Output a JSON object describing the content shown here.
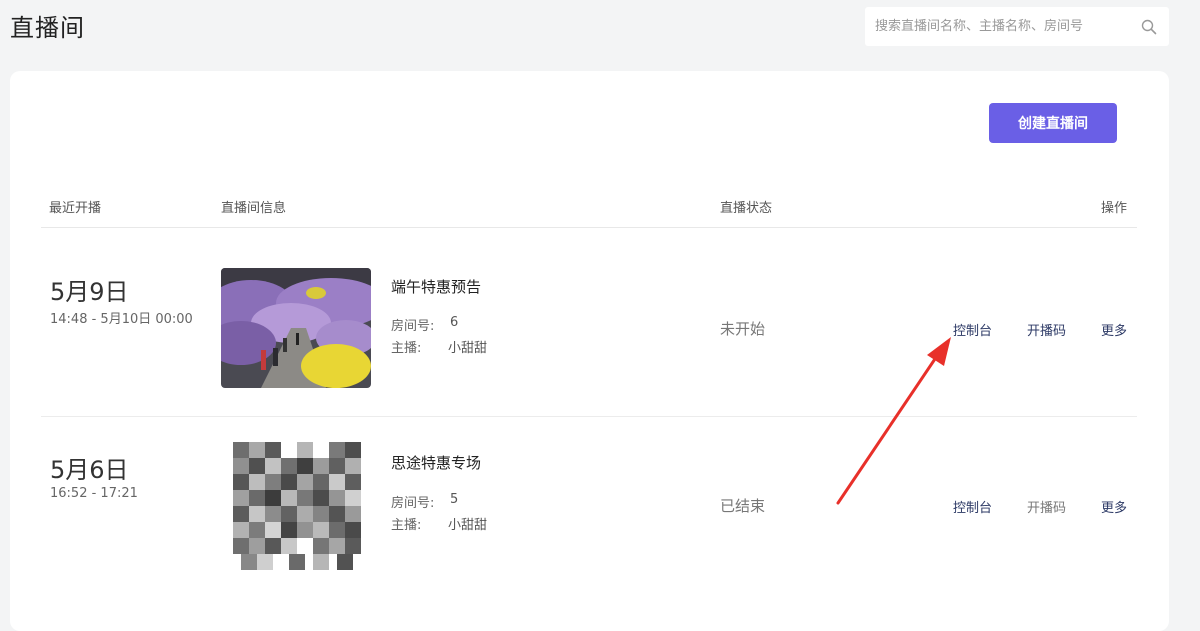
{
  "header": {
    "title": "直播间",
    "search_placeholder": "搜索直播间名称、主播名称、房间号"
  },
  "toolbar": {
    "create_label": "创建直播间"
  },
  "table": {
    "columns": [
      "最近开播",
      "直播间信息",
      "直播状态",
      "操作"
    ],
    "rows": [
      {
        "date": "5月9日",
        "time_range": "14:48 - 5月10日 00:00",
        "name": "端午特惠预告",
        "room_label": "房间号:",
        "room_no": "6",
        "host_label": "主播:",
        "host": "小甜甜",
        "status": "未开始",
        "actions": [
          "控制台",
          "开播码",
          "更多"
        ]
      },
      {
        "date": "5月6日",
        "time_range": "16:52 - 17:21",
        "name": "思途特惠专场",
        "room_label": "房间号:",
        "room_no": "5",
        "host_label": "主播:",
        "host": "小甜甜",
        "status": "已结束",
        "actions": [
          "控制台",
          "开播码",
          "更多"
        ]
      }
    ]
  },
  "colors": {
    "accent": "#6a5fe6",
    "arrow": "#e8302a"
  }
}
